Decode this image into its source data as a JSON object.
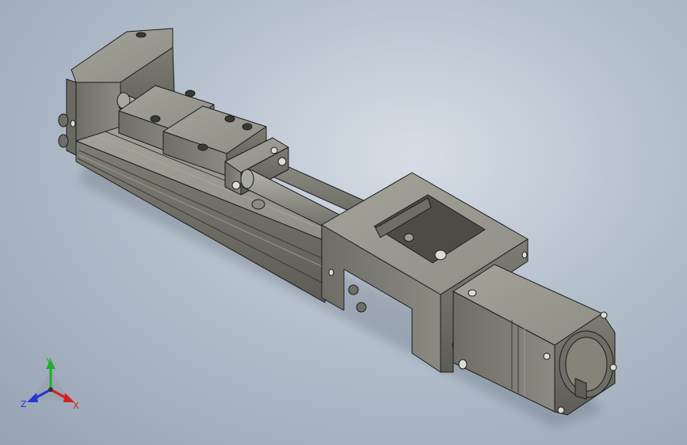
{
  "viewport": {
    "background_top": "#d6dde6",
    "background_bottom": "#97a3b3"
  },
  "model": {
    "description_icon": "linear-actuator-module",
    "body_color": "#8a8a80",
    "shadow_color": "#5e5e56",
    "edge_color": "#1c1c1c"
  },
  "triad": {
    "x_label": "X",
    "y_label": "Y",
    "z_label": "Z",
    "x_color": "#d42020",
    "y_color": "#1fae2a",
    "z_color": "#2436d6"
  }
}
